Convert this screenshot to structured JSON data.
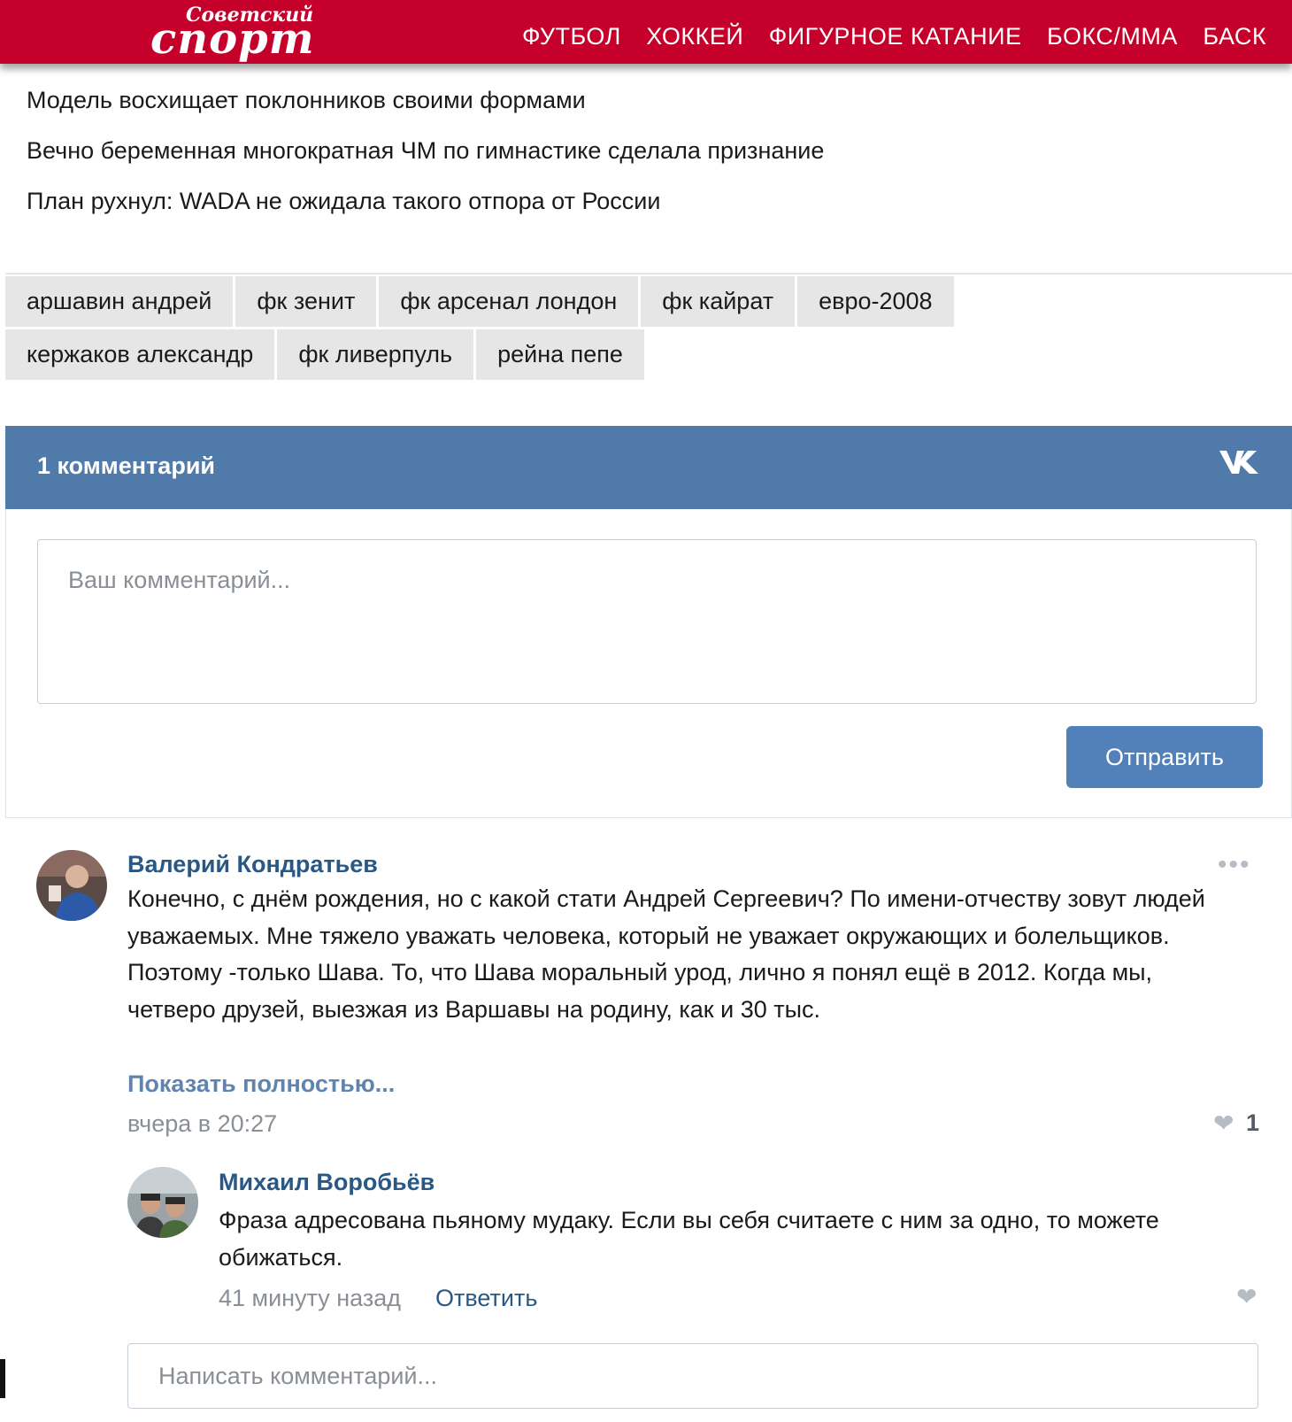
{
  "header": {
    "logo_small": "Советский",
    "logo_big": "спорт",
    "nav": [
      "ФУТБОЛ",
      "ХОККЕЙ",
      "ФИГУРНОЕ КАТАНИЕ",
      "БОКС/ММА",
      "БАСК"
    ],
    "brand_color": "#c4002b"
  },
  "related": [
    "Модель восхищает поклонников своими формами",
    "Вечно беременная многократная ЧМ по гимнастике сделала признание",
    "План рухнул: WADA не ожидала такого отпора от России"
  ],
  "tags": {
    "row1": [
      "аршавин андрей",
      "фк зенит",
      "фк арсенал лондон",
      "фк кайрат",
      "евро-2008"
    ],
    "row2": [
      "кержаков александр",
      "фк ливерпуль",
      "рейна пепе"
    ]
  },
  "vk": {
    "title": "1 комментарий",
    "logo": "VK",
    "textarea_placeholder": "Ваш комментарий...",
    "send_label": "Отправить",
    "header_color": "#507aaa",
    "button_color": "#5181b8"
  },
  "comments": [
    {
      "author": "Валерий Кондратьев",
      "text": "Конечно, с днём рождения, но с какой стати Андрей Сергеевич? По имени-отчеству зовут людей уважаемых. Мне тяжело уважать человека, который не уважает окружающих и болельщиков. Поэтому -только Шава. То, что Шава моральный урод, лично я понял ещё в 2012. Когда мы, четверо друзей, выезжая из Варшавы на родину, как и 30 тыс.",
      "show_more": "Показать полностью...",
      "time": "вчера в 20:27",
      "likes": "1",
      "more_icon": "•••"
    },
    {
      "author": "Михаил Воробьёв",
      "text": "Фраза адресована пьяному мудаку. Если вы себя считаете с ним за одно, то можете обижаться.",
      "time": "41 минуту назад",
      "reply": "Ответить"
    }
  ],
  "write_placeholder": "Написать комментарий...",
  "icons": {
    "heart": "heart-icon",
    "more": "more-dots-icon",
    "vk": "vk-logo-icon"
  }
}
